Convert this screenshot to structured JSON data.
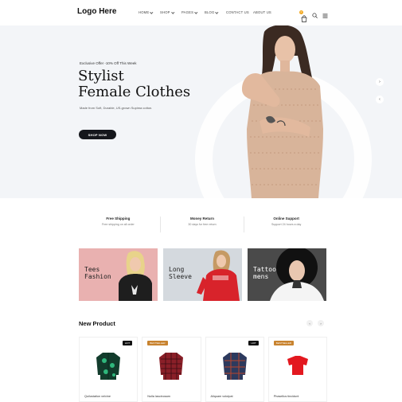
{
  "header": {
    "logo": "Logo Here",
    "nav": [
      {
        "label": "HOME",
        "dropdown": true
      },
      {
        "label": "SHOP",
        "dropdown": true
      },
      {
        "label": "PAGES",
        "dropdown": true
      },
      {
        "label": "BLOG",
        "dropdown": true
      },
      {
        "label": "CONTACT US",
        "dropdown": false
      },
      {
        "label": "ABOUT US",
        "dropdown": false
      }
    ],
    "cart_count": "0",
    "icons": [
      "cart-icon",
      "search-icon",
      "menu-icon"
    ]
  },
  "hero": {
    "offer": "Exclusive Offer -10% Off This Week",
    "title_line1": "Stylist",
    "title_line2": "Female Clothes",
    "subtitle": "Made from Soft, Durable, US-grown Supima cotton.",
    "button": "SHOP NOW",
    "arrows": [
      "›",
      "‹"
    ]
  },
  "features": [
    {
      "title": "Free Shipping",
      "desc": "Free shipping on all order"
    },
    {
      "title": "Money Return",
      "desc": "30 days for free return"
    },
    {
      "title": "Online Support",
      "desc": "Support 24 hours a day"
    }
  ],
  "banners": [
    {
      "line1": "Tees",
      "line2": "Fashion",
      "bg": "#e9b1b0"
    },
    {
      "line1": "Long",
      "line2": "Sleeve",
      "bg": "#d4d9de"
    },
    {
      "line1": "Tattoo",
      "line2": "mens",
      "bg": "#4a4a4a"
    }
  ],
  "new_product": {
    "title": "New Product",
    "prev": "‹",
    "next": "›",
    "items": [
      {
        "name": "Quilustation velvine",
        "tag": "HOT",
        "tag_color": "#111111"
      },
      {
        "name": "Nulla lascinosam",
        "tag": "BESTSELLER",
        "tag_color": "#c8832f"
      },
      {
        "name": "Aliquam volutpat",
        "tag": "HOT",
        "tag_color": "#111111"
      },
      {
        "name": "Phasellus tincidunt",
        "tag": "BESTSELLER",
        "tag_color": "#c8832f"
      }
    ]
  },
  "colors": {
    "accent": "#f2a922",
    "dark_button": "#15171c",
    "hero_bg": "#f3f5f8"
  }
}
